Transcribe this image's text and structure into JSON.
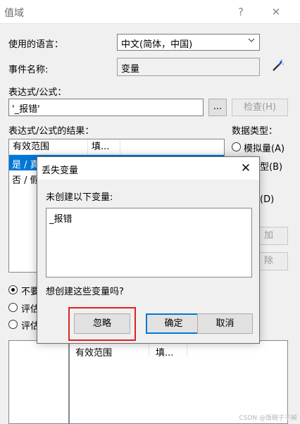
{
  "window": {
    "title": "值域",
    "help_glyph": "?",
    "close_glyph": "✕"
  },
  "form": {
    "language_label": "使用的语言：",
    "language_value": "中文(简体，中国)",
    "event_label": "事件名称:",
    "event_value": "变量",
    "expression_label": "表达式/公式：",
    "expression_value": "'_报错'",
    "dots_label": "...",
    "check_label": "检查(H)",
    "result_label": "表达式/公式的结果：",
    "result_columns": [
      "有效范围",
      "填..."
    ],
    "result_rows": [
      "是 / 真",
      "否 / 假"
    ],
    "datatype_label": "数据类型：",
    "datatype_options": [
      "模拟量(A)",
      "型(B)",
      "(D)"
    ],
    "radio_options": [
      "不要",
      "评估",
      "评估"
    ],
    "add_label": "加",
    "delete_label": "除",
    "bottom_columns": [
      "有效范围",
      "填..."
    ]
  },
  "dialog": {
    "title": "丢失变量",
    "close_glyph": "✕",
    "message": "未创建以下变量:",
    "variable": "_报错",
    "question": "想创建这些变量吗?",
    "ignore_label": "忽略",
    "ok_label": "确定",
    "cancel_label": "取消"
  },
  "watermark": "CSDN @饭碗子不掉",
  "icons": {
    "dropdown": "chevron-down-icon",
    "wand": "magic-wand-icon"
  },
  "colors": {
    "selection": "#0078d7",
    "highlight": "#e02020"
  }
}
